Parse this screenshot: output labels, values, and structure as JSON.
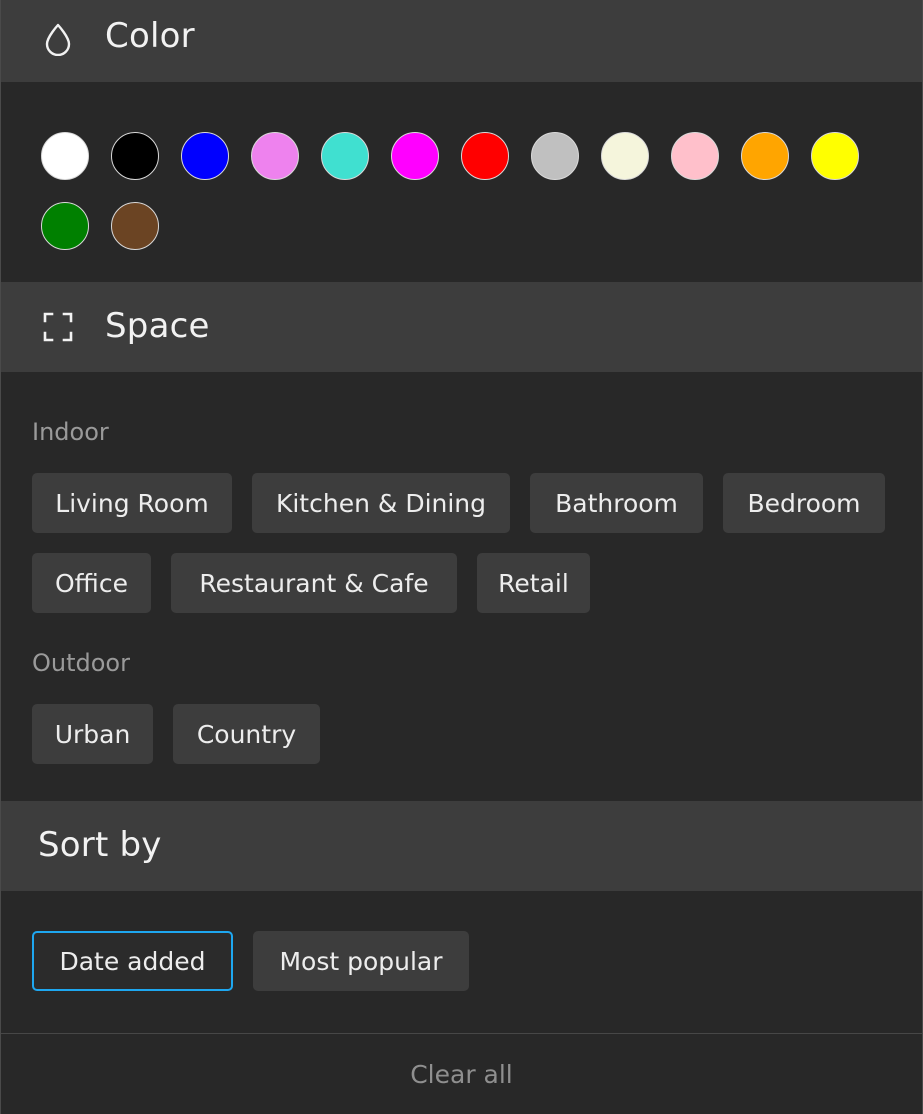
{
  "color": {
    "title": "Color",
    "icon": "drop-icon",
    "swatches": [
      {
        "name": "white",
        "hex": "#ffffff"
      },
      {
        "name": "black",
        "hex": "#000000"
      },
      {
        "name": "blue",
        "hex": "#0000ff"
      },
      {
        "name": "violet",
        "hex": "#ee82ee"
      },
      {
        "name": "turquoise",
        "hex": "#40e0d0"
      },
      {
        "name": "magenta",
        "hex": "#ff00ff"
      },
      {
        "name": "red",
        "hex": "#ff0000"
      },
      {
        "name": "silver",
        "hex": "#c0c0c0"
      },
      {
        "name": "beige",
        "hex": "#f5f5dc"
      },
      {
        "name": "pink",
        "hex": "#ffc0cb"
      },
      {
        "name": "orange",
        "hex": "#ffa500"
      },
      {
        "name": "yellow",
        "hex": "#ffff00"
      },
      {
        "name": "green",
        "hex": "#008000"
      },
      {
        "name": "brown",
        "hex": "#6b4423"
      }
    ]
  },
  "space": {
    "title": "Space",
    "icon": "frame-corners-icon",
    "indoor_label": "Indoor",
    "indoor": [
      "Living Room",
      "Kitchen & Dining",
      "Bathroom",
      "Bedroom",
      "Office",
      "Restaurant & Cafe",
      "Retail"
    ],
    "outdoor_label": "Outdoor",
    "outdoor": [
      "Urban",
      "Country"
    ]
  },
  "sort": {
    "title": "Sort by",
    "options": [
      "Date added",
      "Most popular"
    ],
    "selected": "Date added",
    "accent_color": "#1ea7f0"
  },
  "footer": {
    "clear_all": "Clear all"
  }
}
